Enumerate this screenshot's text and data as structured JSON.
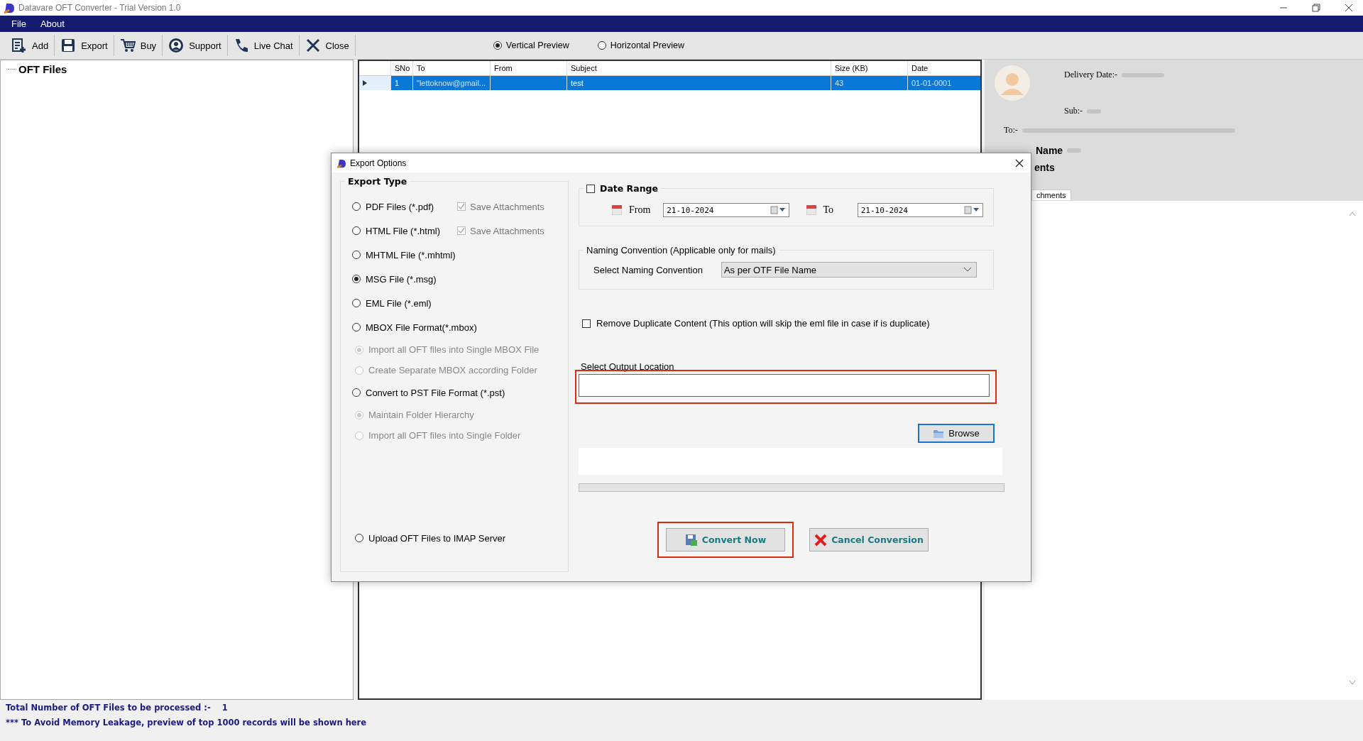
{
  "app": {
    "title": "Datavare OFT Converter - Trial Version 1.0"
  },
  "menu": [
    {
      "label": "File"
    },
    {
      "label": "About"
    }
  ],
  "toolbar": [
    {
      "label": "Add",
      "kind": "add"
    },
    {
      "label": "Export",
      "kind": "export"
    },
    {
      "label": "Buy",
      "kind": "buy"
    },
    {
      "label": "Support",
      "kind": "support"
    },
    {
      "label": "Live Chat",
      "kind": "chat"
    },
    {
      "label": "Close",
      "kind": "close"
    }
  ],
  "preview_mode": [
    {
      "label": "Vertical Preview",
      "selected": true
    },
    {
      "label": "Horizontal Preview",
      "selected": false
    }
  ],
  "tree": {
    "root": "OFT Files"
  },
  "grid": {
    "columns": [
      "SNo",
      "To",
      "From",
      "Subject",
      "Size (KB)",
      "Date"
    ],
    "rows": [
      {
        "selected": true,
        "sno": "1",
        "to": "\"lettoknow@gmail...",
        "subject": "test",
        "size": "43",
        "date": "01-01-0001"
      }
    ]
  },
  "preview": {
    "delivery_label": "Delivery Date:-",
    "sub_label": "Sub:-",
    "to_label": "To:-",
    "name_label": "Name",
    "attach_label": "ents",
    "tab": "chments"
  },
  "dialog": {
    "title": "Export Options",
    "export_type": {
      "title": "Export Type",
      "options": [
        {
          "kind": "main",
          "label": "PDF Files (*.pdf)",
          "selected": false,
          "extra": {
            "label": "Save Attachments",
            "checked": true
          }
        },
        {
          "kind": "main",
          "label": "HTML File  (*.html)",
          "selected": false,
          "extra": {
            "label": "Save Attachments",
            "checked": true
          }
        },
        {
          "kind": "main",
          "label": "MHTML File  (*.mhtml)",
          "selected": false
        },
        {
          "kind": "main",
          "label": "MSG File (*.msg)",
          "selected": true
        },
        {
          "kind": "main",
          "label": "EML File (*.eml)",
          "selected": false
        },
        {
          "kind": "main",
          "label": "MBOX File Format(*.mbox)",
          "selected": false
        },
        {
          "kind": "sub",
          "label": "Import all OFT files into Single MBOX File",
          "selected": true
        },
        {
          "kind": "sub",
          "label": "Create Separate MBOX according Folder",
          "selected": false
        },
        {
          "kind": "main",
          "label": "Convert to PST File Format (*.pst)",
          "selected": false
        },
        {
          "kind": "sub",
          "label": "Maintain Folder Hierarchy",
          "selected": true
        },
        {
          "kind": "sub",
          "label": "Import all OFT files into Single Folder",
          "selected": false
        },
        {
          "kind": "last",
          "label": "Upload OFT Files to IMAP Server",
          "selected": false
        }
      ]
    },
    "date_range": {
      "label": "Date Range",
      "checked": false,
      "from_label": "From",
      "from": "21-10-2024",
      "to_label": "To",
      "to": "21-10-2024"
    },
    "naming": {
      "title": "Naming Convention (Applicable only for mails)",
      "label": "Select Naming Convention",
      "value": "As per OTF File Name"
    },
    "remove_duplicate": {
      "label": "Remove Duplicate Content (This option will skip the eml file in case if is duplicate)",
      "checked": false
    },
    "output": {
      "label": "Select Output Location"
    },
    "browse": "Browse",
    "progress": {
      "level": 0
    },
    "buttons": [
      {
        "label": "Convert Now",
        "kind": "convert"
      },
      {
        "label": "Cancel Conversion",
        "kind": "cancel"
      }
    ]
  },
  "status": {
    "count_label": "Total Number of OFT Files to be processed :-",
    "count": "1",
    "note": "*** To Avoid Memory Leakage, preview of top 1000 records will be shown here"
  }
}
